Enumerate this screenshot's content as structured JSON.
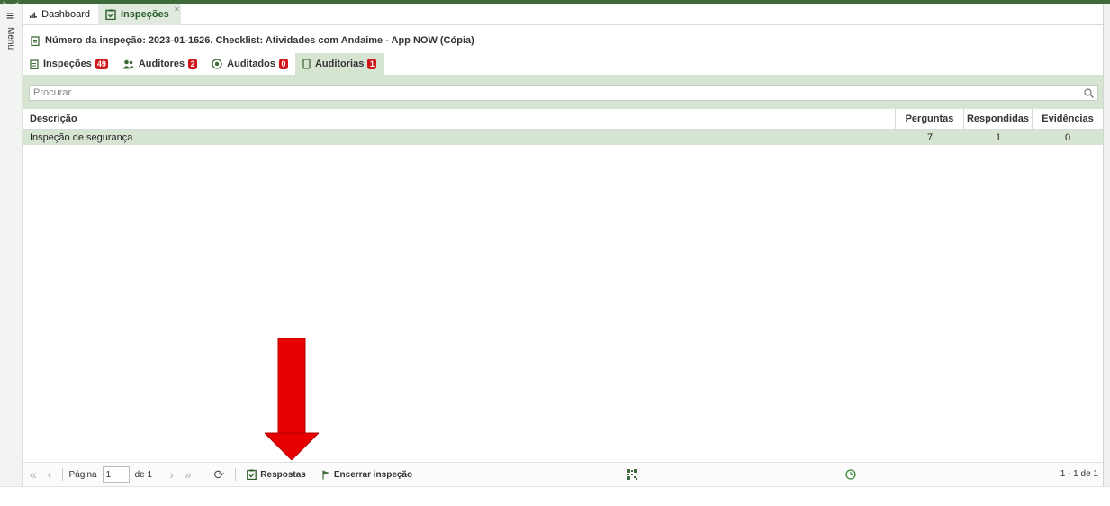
{
  "tabs": [
    {
      "label": "Dashboard",
      "icon": "bar-chart-icon",
      "active": false
    },
    {
      "label": "Inspeções",
      "icon": "clipboard-check-icon",
      "active": true,
      "close": "×"
    }
  ],
  "menu": {
    "label": "Menu"
  },
  "title": "Número da inspeção: 2023-01-1626. Checklist: Atividades com Andaime - App NOW (Cópia)",
  "subtabs": [
    {
      "label": "Inspeções",
      "count": "49",
      "icon": "clipboard-icon"
    },
    {
      "label": "Auditores",
      "count": "2",
      "icon": "users-icon"
    },
    {
      "label": "Auditados",
      "count": "0",
      "icon": "target-icon"
    },
    {
      "label": "Auditorias",
      "count": "1",
      "icon": "tablet-icon",
      "active": true
    }
  ],
  "search": {
    "placeholder": "Procurar"
  },
  "table": {
    "columns": [
      "Descrição",
      "Perguntas",
      "Respondidas",
      "Evidências"
    ],
    "rows": [
      {
        "descricao": "Inspeção de segurança",
        "perguntas": "7",
        "respondidas": "1",
        "evidencias": "0"
      }
    ]
  },
  "footer": {
    "page_label": "Página",
    "page_value": "1",
    "page_of": "de 1",
    "respostas_label": "Respostas",
    "encerrar_label": "Encerrar inspeção",
    "paging_info": "1 - 1 de 1"
  },
  "colors": {
    "accent": "#3f6b3a",
    "selected": "#d6e4d2",
    "badge": "#d0161a",
    "arrow": "#e60000"
  }
}
